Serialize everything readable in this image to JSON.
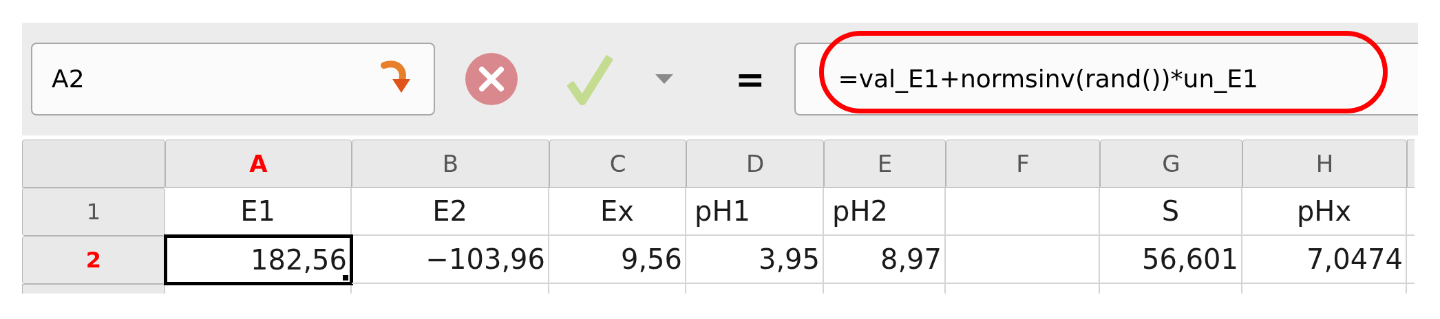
{
  "formula_bar": {
    "name_box": "A2",
    "function_symbol": "=",
    "formula": "=val_E1+normsinv(rand())*un_E1",
    "highlighted": true
  },
  "columns": [
    {
      "label": "A",
      "selected": true
    },
    {
      "label": "B",
      "selected": false
    },
    {
      "label": "C",
      "selected": false
    },
    {
      "label": "D",
      "selected": false
    },
    {
      "label": "E",
      "selected": false
    },
    {
      "label": "F",
      "selected": false
    },
    {
      "label": "G",
      "selected": false
    },
    {
      "label": "H",
      "selected": false
    }
  ],
  "rows": [
    {
      "label": "1",
      "selected": false,
      "cells": [
        {
          "text": "E1",
          "selected": false
        },
        {
          "text": "E2",
          "selected": false
        },
        {
          "text": "Ex",
          "selected": false
        },
        {
          "text": "pH1",
          "selected": false
        },
        {
          "text": "pH2",
          "selected": false
        },
        {
          "selected": false
        },
        {
          "text": "S",
          "selected": false
        },
        {
          "text": "pHx",
          "selected": false
        }
      ]
    },
    {
      "label": "2",
      "selected": true,
      "cells": [
        {
          "text": "182,56",
          "selected": true
        },
        {
          "text": "−103,96",
          "selected": false
        },
        {
          "text": "9,56",
          "selected": false
        },
        {
          "text": "3,95",
          "selected": false
        },
        {
          "text": "8,97",
          "selected": false
        },
        {
          "selected": false
        },
        {
          "text": "56,601",
          "selected": false
        },
        {
          "text": "7,0474",
          "selected": false
        }
      ]
    }
  ]
}
